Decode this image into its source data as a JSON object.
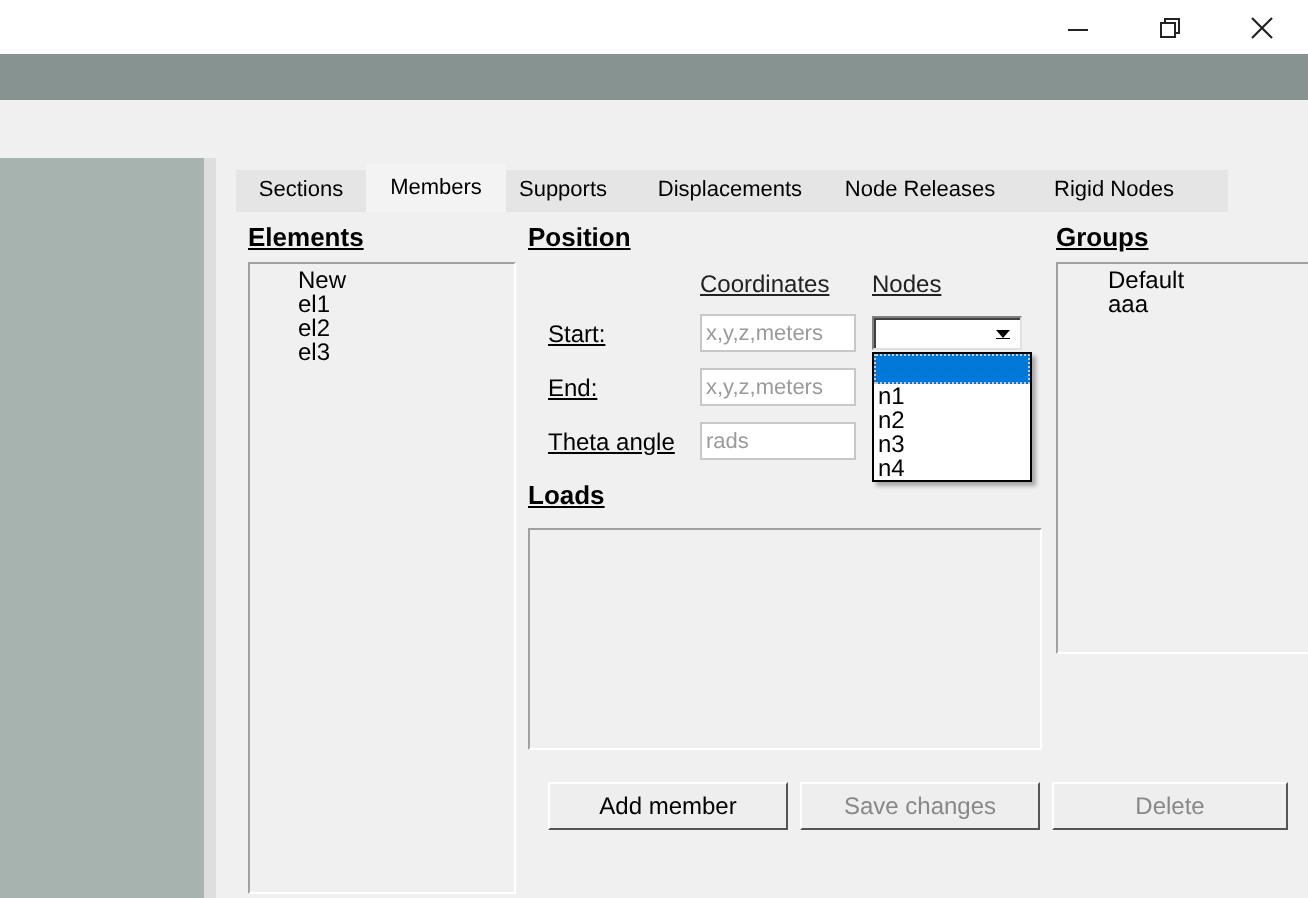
{
  "tabs": [
    {
      "label": "Sections",
      "selected": false
    },
    {
      "label": "Members",
      "selected": true
    },
    {
      "label": "Supports",
      "selected": false
    },
    {
      "label": "Displacements",
      "selected": false
    },
    {
      "label": "Node Releases",
      "selected": false
    },
    {
      "label": "Rigid Nodes",
      "selected": false
    }
  ],
  "elements": {
    "title": "Elements",
    "items": [
      "New",
      "el1",
      "el2",
      "el3"
    ]
  },
  "position": {
    "title": "Position",
    "coordinates_header": "Coordinates",
    "nodes_header": "Nodes",
    "rows": [
      {
        "label": "Start:",
        "placeholder": "x,y,z,meters"
      },
      {
        "label": "End:",
        "placeholder": "x,y,z,meters"
      },
      {
        "label": "Theta angle",
        "placeholder": "rads"
      }
    ]
  },
  "nodes_dropdown": {
    "open": true,
    "blank_highlighted": true,
    "options": [
      "n1",
      "n2",
      "n3",
      "n4"
    ]
  },
  "loads": {
    "title": "Loads"
  },
  "groups": {
    "title": "Groups",
    "items": [
      "Default",
      "aaa"
    ]
  },
  "buttons": [
    {
      "label": "Add member",
      "disabled": false
    },
    {
      "label": "Save changes",
      "disabled": true
    },
    {
      "label": "Delete",
      "disabled": true
    }
  ]
}
